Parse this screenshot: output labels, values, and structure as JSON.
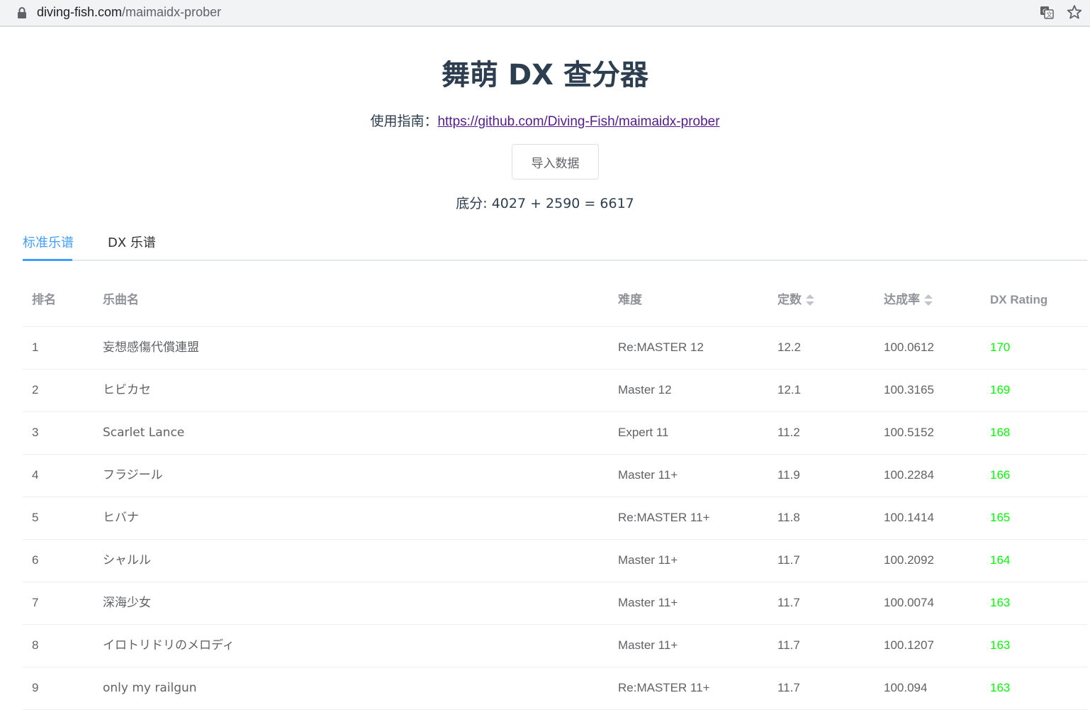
{
  "browser": {
    "url_domain": "diving-fish.com",
    "url_path": "/maimaidx-prober"
  },
  "header": {
    "title": "舞萌 DX 查分器",
    "guide_label": "使用指南：",
    "guide_link": "https://github.com/Diving-Fish/maimaidx-prober",
    "import_button": "导入数据",
    "score_text": "底分: 4027 + 2590 = 6617"
  },
  "tabs": [
    {
      "label": "标准乐谱",
      "active": true
    },
    {
      "label": "DX 乐谱",
      "active": false
    }
  ],
  "table": {
    "headers": {
      "rank": "排名",
      "song": "乐曲名",
      "difficulty": "难度",
      "constant": "定数",
      "rate": "达成率",
      "rating": "DX Rating"
    },
    "rows": [
      {
        "rank": "1",
        "song": "妄想感傷代償連盟",
        "difficulty": "Re:MASTER 12",
        "constant": "12.2",
        "rate": "100.0612",
        "rating": "170"
      },
      {
        "rank": "2",
        "song": "ヒビカセ",
        "difficulty": "Master 12",
        "constant": "12.1",
        "rate": "100.3165",
        "rating": "169"
      },
      {
        "rank": "3",
        "song": "Scarlet Lance",
        "difficulty": "Expert 11",
        "constant": "11.2",
        "rate": "100.5152",
        "rating": "168"
      },
      {
        "rank": "4",
        "song": "フラジール",
        "difficulty": "Master 11+",
        "constant": "11.9",
        "rate": "100.2284",
        "rating": "166"
      },
      {
        "rank": "5",
        "song": "ヒバナ",
        "difficulty": "Re:MASTER 11+",
        "constant": "11.8",
        "rate": "100.1414",
        "rating": "165"
      },
      {
        "rank": "6",
        "song": "シャルル",
        "difficulty": "Master 11+",
        "constant": "11.7",
        "rate": "100.2092",
        "rating": "164"
      },
      {
        "rank": "7",
        "song": "深海少女",
        "difficulty": "Master 11+",
        "constant": "11.7",
        "rate": "100.0074",
        "rating": "163"
      },
      {
        "rank": "8",
        "song": "イロトリドリのメロディ",
        "difficulty": "Master 11+",
        "constant": "11.7",
        "rate": "100.1207",
        "rating": "163"
      },
      {
        "rank": "9",
        "song": "only my railgun",
        "difficulty": "Re:MASTER 11+",
        "constant": "11.7",
        "rate": "100.094",
        "rating": "163"
      }
    ]
  },
  "colors": {
    "accent": "#409eff",
    "rating": "#00ff00",
    "link": "#551a8b"
  }
}
